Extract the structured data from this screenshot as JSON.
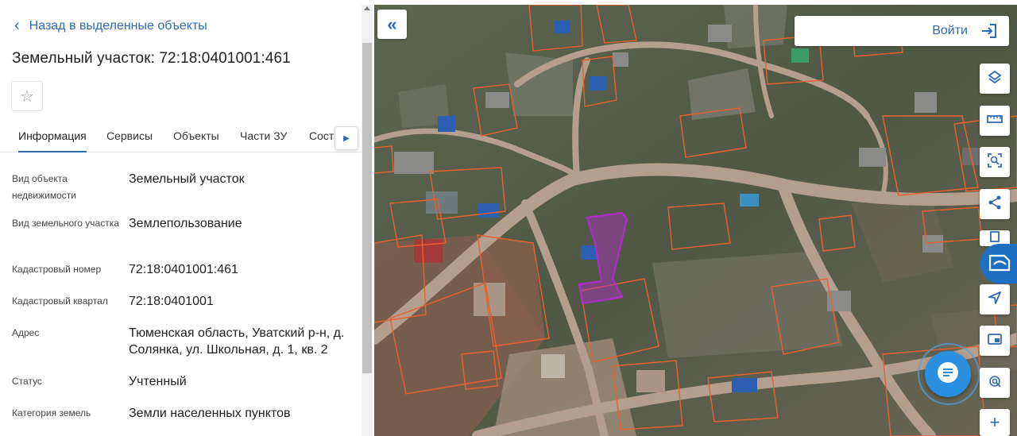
{
  "panel": {
    "back_label": "Назад в выделенные объекты",
    "title": "Земельный участок: 72:18:0401001:461",
    "tabs": [
      "Информация",
      "Сервисы",
      "Объекты",
      "Части ЗУ",
      "Состав"
    ],
    "active_tab": "Информация",
    "fields": [
      {
        "label": "Вид объекта недвижимости",
        "value": "Земельный участок"
      },
      {
        "label": "Вид земельного участка",
        "value": "Землепользование"
      },
      {
        "label": "Кадастровый номер",
        "value": "72:18:0401001:461"
      },
      {
        "label": "Кадастровый квартал",
        "value": "72:18:0401001"
      },
      {
        "label": "Адрес",
        "value": "Тюменская область, Уватский р-н, д. Солянка, ул. Школьная, д. 1, кв. 2"
      },
      {
        "label": "Статус",
        "value": "Учтенный"
      },
      {
        "label": "Категория земель",
        "value": "Земли населенных пунктов"
      }
    ]
  },
  "map": {
    "login_label": "Войти",
    "tools": [
      "layers-icon",
      "ruler-icon",
      "area-select-icon",
      "share-icon",
      "print-icon",
      "locate-icon",
      "minimap-icon",
      "fingerprint-icon",
      "zoom-in-icon"
    ],
    "colors": {
      "accent": "#2f6bb3",
      "parcel_border": "#e8602c",
      "selected_parcel": "#b02cc8",
      "road": "#b8a090"
    }
  }
}
